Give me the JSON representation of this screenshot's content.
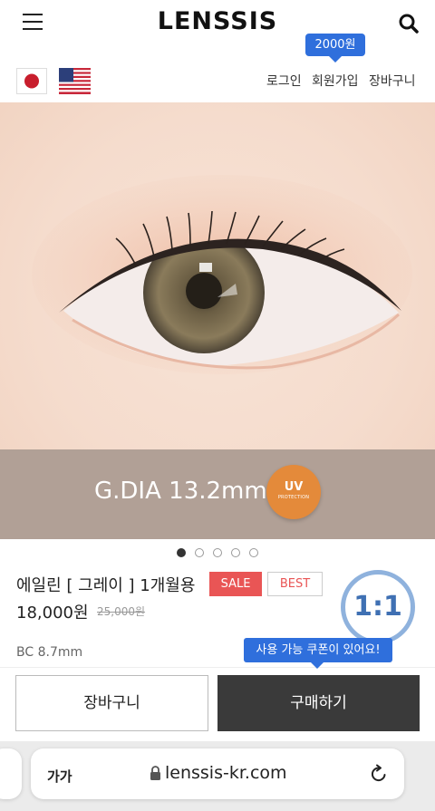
{
  "header": {
    "logo": "LENSSIS"
  },
  "util": {
    "login": "로그인",
    "signup": "회원가입",
    "cart": "장바구니",
    "signup_bonus": "2000원"
  },
  "hero": {
    "dia_label": "G.DIA 13.2mm",
    "uv_badge_text": "UV",
    "uv_badge_sub": "PROTECTION"
  },
  "carousel": {
    "slide_count": 5,
    "active_index": 0
  },
  "product": {
    "name": "에일린 [ 그레이 ] 1개월용",
    "tags": {
      "sale": "SALE",
      "best": "BEST"
    },
    "price": "18,000원",
    "original_price": "25,000원",
    "one_to_one": "1:1",
    "bc": "BC 8.7mm",
    "coupon_tooltip": "사용 가능 쿠폰이 있어요!"
  },
  "actions": {
    "cart": "장바구니",
    "buy": "구매하기"
  },
  "browser": {
    "text_size": "가가",
    "url": "lenssis-kr.com"
  },
  "colors": {
    "accent_blue": "#2f6fdc",
    "sale_red": "#e95555",
    "buy_dark": "#3a3a3a",
    "uv_orange": "#e48a3a"
  }
}
